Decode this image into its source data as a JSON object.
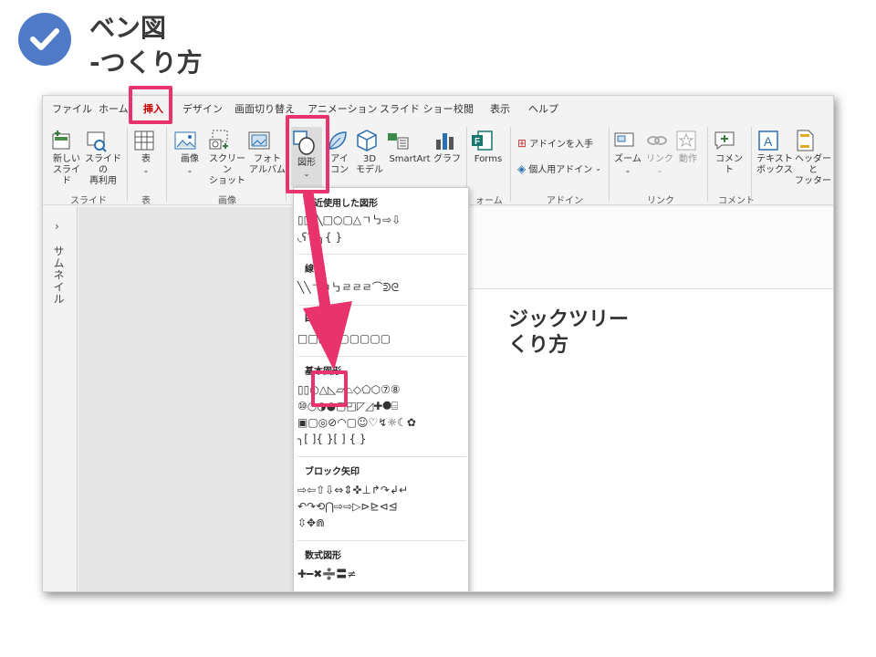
{
  "header": {
    "check_icon": "check-circle-icon",
    "title_line1": "ベン図",
    "title_line2": "-つくり方",
    "accent_color": "#4f7ac7"
  },
  "highlight_color": "#e8336d",
  "tabs": [
    "ファイル",
    "ホーム",
    "挿入",
    "デザイン",
    "画面切り替え",
    "アニメーション",
    "スライド ショー",
    "校閲",
    "表示",
    "ヘルプ"
  ],
  "active_tab": "挿入",
  "ribbon": {
    "new_slide": "新しい\nスライド",
    "reuse_slide": "スライドの\n再利用",
    "table": "表",
    "image": "画像",
    "screenshot": "スクリーン\nショット",
    "photo_album": "フォト\nアルバム",
    "shapes": "図形",
    "icons": "アイ\nコン",
    "model_3d": "3D\nモデル",
    "smartart": "SmartArt",
    "graph": "グラフ",
    "forms": "Forms",
    "get_addins": "アドインを入手",
    "personal_addins": "個人用アドイン",
    "zoom": "ズーム",
    "link": "リンク",
    "action": "動作",
    "comment": "コメント",
    "textbox": "テキスト\nボックス",
    "header_footer": "ヘッダーと\nフッター",
    "groups": {
      "slide": "スライド",
      "table": "表",
      "image": "画像",
      "forms": "ォーム",
      "addins": "アドイン",
      "link": "リンク",
      "comment": "コメント"
    }
  },
  "thumbnail_pane": {
    "chevron": "›",
    "label": "サムネイル"
  },
  "slide": {
    "line1": "ジックツリー",
    "line2": "くり方"
  },
  "dropdown": {
    "recent_title": "最近使用した図形",
    "recent_row1": "▯▯╲╲□○▢△ㄱ㇉⇨⇩",
    "recent_row2": "◟ʕ⌒╮{ }",
    "lines_title": "線",
    "lines_row": "╲╲ㄱㄱ㇉ㄹㄹㄹ⌒ᕲᘓ",
    "rect_title": "四",
    "rect_row": "□□▢▢▢▢▢▢▢",
    "basic_title": "基本図形",
    "basic_row1": "▯▯○△◺▱⏢◇⬠⬡⑦⑧",
    "basic_row2": "⑩◔◑◕▢◰◸◿✚⯃⌸",
    "basic_row3": "▣▢◎⊘◠▢☺♡↯☼☾✿",
    "basic_row4": "╮[ ]{ }[ ] { }",
    "block_title": "ブロック矢印",
    "block_row1": "⇨⇦⇧⇩⇔⇕✜⊥↱↷↲↵",
    "block_row2": "↶↷⟲⋂⇨⇨▷⊳⊵⊲⊴",
    "block_row3": "⇳✥⋒",
    "math_title": "数式図形",
    "math_row": "✚━✖➗〓≠"
  }
}
